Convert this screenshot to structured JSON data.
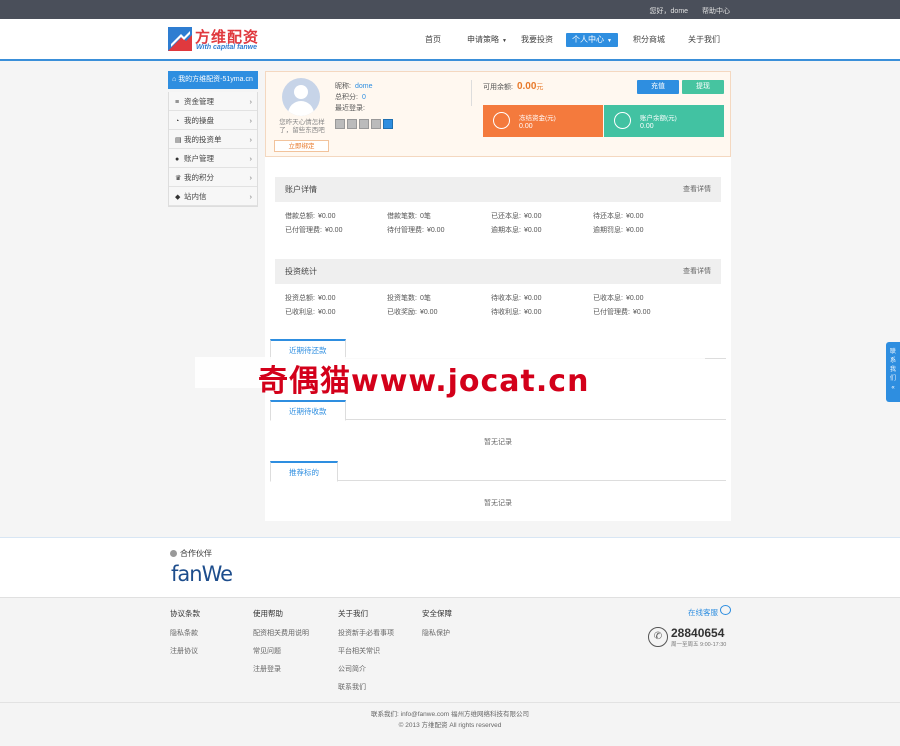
{
  "topbar": {
    "greeting": "您好，dome",
    "help": "帮助中心"
  },
  "logo": {
    "cn": "方维配资",
    "en": "With capital fanwe"
  },
  "nav": [
    {
      "label": "首页",
      "caret": false
    },
    {
      "label": "申请策略",
      "caret": true
    },
    {
      "label": "我要投资",
      "caret": false
    },
    {
      "label": "个人中心",
      "caret": true,
      "active": true
    },
    {
      "label": "积分商城",
      "caret": false
    },
    {
      "label": "关于我们",
      "caret": false
    }
  ],
  "sidebar": {
    "title": "我的方维配资-51yma.cn",
    "items": [
      {
        "label": "资金管理",
        "icon": "database-icon"
      },
      {
        "label": "我的操盘",
        "icon": "clock-icon"
      },
      {
        "label": "我的投资单",
        "icon": "list-icon"
      },
      {
        "label": "账户管理",
        "icon": "user-icon"
      },
      {
        "label": "我的积分",
        "icon": "crown-icon"
      },
      {
        "label": "站内信",
        "icon": "bell-icon"
      }
    ]
  },
  "profile": {
    "nick_note": "您昨天心情怎样了，留些东西吧",
    "verify_button": "立即绑定",
    "username_label": "昵称:",
    "username": "dome",
    "points_label": "总积分:",
    "points": "0",
    "last_login_label": "最近登录:",
    "balance_label": "可用余额:",
    "balance": "0.00",
    "balance_unit": "元",
    "recharge": "充值",
    "withdraw": "提现",
    "frozen_label": "冻结资金(元)",
    "frozen_value": "0.00",
    "reward_label": "账户余额(元)",
    "reward_value": "0.00"
  },
  "account_detail": {
    "title": "账户详情",
    "more": "查看详情",
    "rows": [
      [
        {
          "k": "借款总额:",
          "v": "¥0.00"
        },
        {
          "k": "借款笔数:",
          "v": "0笔"
        },
        {
          "k": "已还本息:",
          "v": "¥0.00"
        },
        {
          "k": "待还本息:",
          "v": "¥0.00"
        }
      ],
      [
        {
          "k": "已付管理费:",
          "v": "¥0.00"
        },
        {
          "k": "待付管理费:",
          "v": "¥0.00"
        },
        {
          "k": "逾期本息:",
          "v": "¥0.00"
        },
        {
          "k": "逾期罚息:",
          "v": "¥0.00"
        }
      ]
    ]
  },
  "invest_stats": {
    "title": "投资统计",
    "more": "查看详情",
    "rows": [
      [
        {
          "k": "投资总额:",
          "v": "¥0.00"
        },
        {
          "k": "投资笔数:",
          "v": "0笔"
        },
        {
          "k": "待收本息:",
          "v": "¥0.00"
        },
        {
          "k": "已收本息:",
          "v": "¥0.00"
        }
      ],
      [
        {
          "k": "已收利息:",
          "v": "¥0.00"
        },
        {
          "k": "已收奖励:",
          "v": "¥0.00"
        },
        {
          "k": "待收利息:",
          "v": "¥0.00"
        },
        {
          "k": "已付管理费:",
          "v": "¥0.00"
        }
      ]
    ]
  },
  "tabs": {
    "repay": {
      "label": "近期待还款"
    },
    "collect": {
      "label": "近期待收款",
      "empty": "暂无记录"
    },
    "recommend": {
      "label": "推荐标的",
      "empty": "暂无记录"
    }
  },
  "watermark": "奇偶猫www.jocat.cn",
  "float_tab": "联系我们",
  "partners": {
    "title": "合作伙伴",
    "logo_text": "fanWe"
  },
  "footer": {
    "cols": [
      {
        "h": "协议条款",
        "links": [
          "隐私条款",
          "注册协议"
        ]
      },
      {
        "h": "使用帮助",
        "links": [
          "配资相关费用说明",
          "常见问题",
          "注册登录"
        ]
      },
      {
        "h": "关于我们",
        "links": [
          "投资新手必看事项",
          "平台相关常识",
          "公司简介",
          "联系我们"
        ]
      },
      {
        "h": "安全保障",
        "links": [
          "隐私保护"
        ]
      }
    ],
    "online_service": "在线客服",
    "phone": "28840654",
    "hours": "周一至周五 9:00-17:30",
    "contact_line": "联系我们: info@fanwe.com   福州方维网络科技有限公司",
    "copyright": "© 2013 方维配资 All rights reserved"
  }
}
